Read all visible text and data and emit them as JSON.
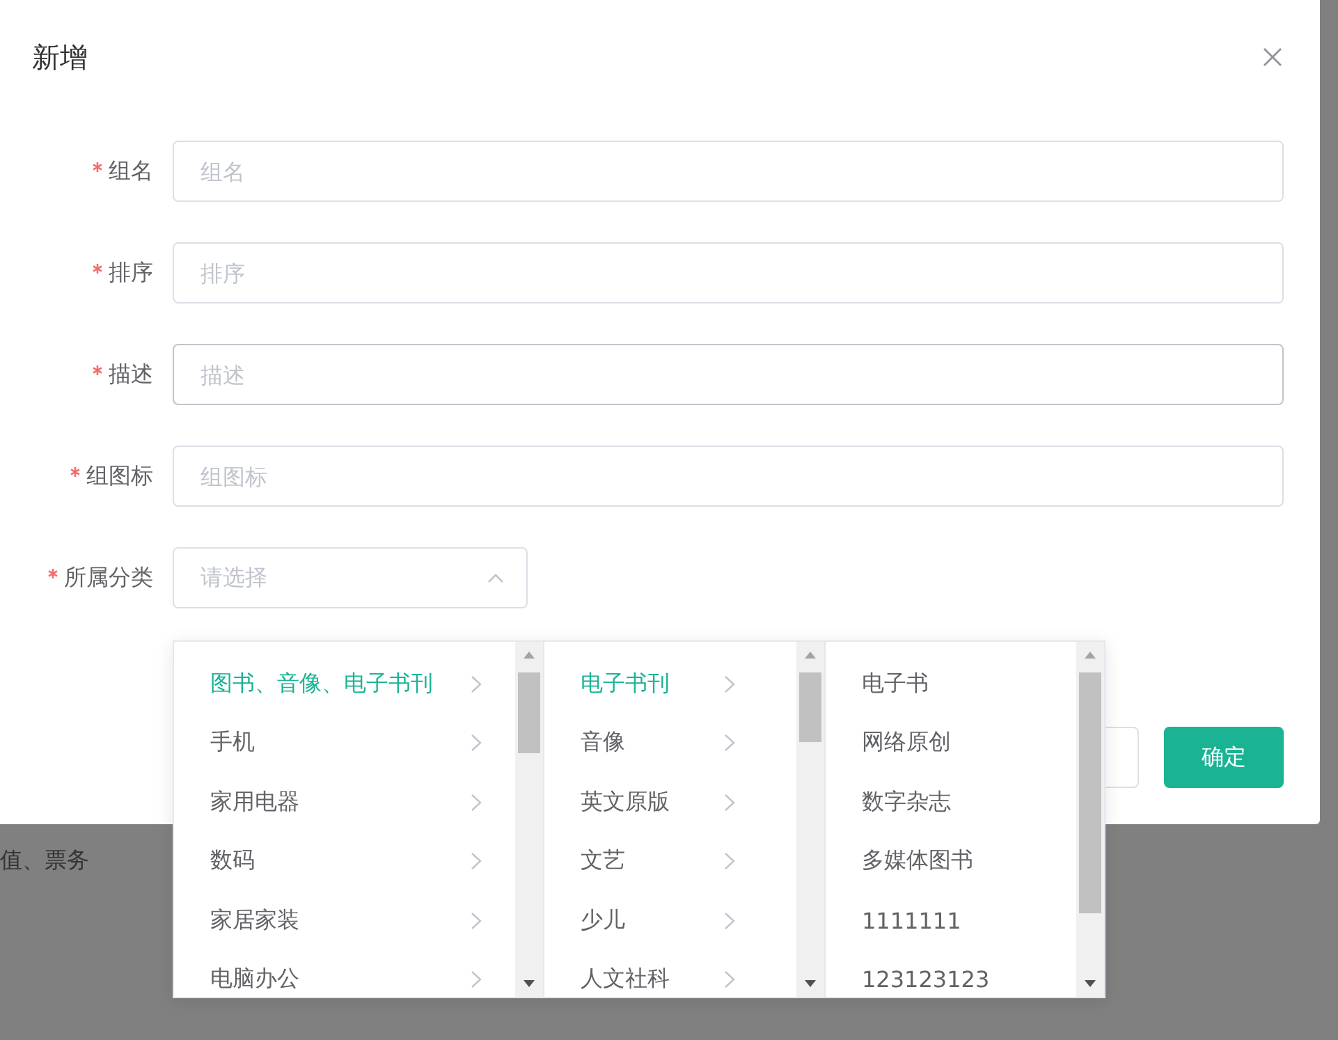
{
  "dialog": {
    "title": "新增",
    "fields": [
      {
        "label": "组名",
        "placeholder": "组名",
        "required": true,
        "kind": "input"
      },
      {
        "label": "排序",
        "placeholder": "排序",
        "required": true,
        "kind": "input"
      },
      {
        "label": "描述",
        "placeholder": "描述",
        "required": true,
        "kind": "input"
      },
      {
        "label": "组图标",
        "placeholder": "组图标",
        "required": true,
        "kind": "input"
      },
      {
        "label": "所属分类",
        "placeholder": "请选择",
        "required": true,
        "kind": "select",
        "expanded": true
      }
    ],
    "cascader": {
      "columns": [
        {
          "items": [
            {
              "label": "图书、音像、电子书刊",
              "selected": true,
              "has_children": true
            },
            {
              "label": "手机",
              "selected": false,
              "has_children": true
            },
            {
              "label": "家用电器",
              "selected": false,
              "has_children": true
            },
            {
              "label": "数码",
              "selected": false,
              "has_children": true
            },
            {
              "label": "家居家装",
              "selected": false,
              "has_children": true
            },
            {
              "label": "电脑办公",
              "selected": false,
              "has_children": true
            }
          ]
        },
        {
          "items": [
            {
              "label": "电子书刊",
              "selected": true,
              "has_children": true
            },
            {
              "label": "音像",
              "selected": false,
              "has_children": true
            },
            {
              "label": "英文原版",
              "selected": false,
              "has_children": true
            },
            {
              "label": "文艺",
              "selected": false,
              "has_children": true
            },
            {
              "label": "少儿",
              "selected": false,
              "has_children": true
            },
            {
              "label": "人文社科",
              "selected": false,
              "has_children": true
            }
          ]
        },
        {
          "items": [
            {
              "label": "电子书",
              "selected": false,
              "has_children": false
            },
            {
              "label": "网络原创",
              "selected": false,
              "has_children": false
            },
            {
              "label": "数字杂志",
              "selected": false,
              "has_children": false
            },
            {
              "label": "多媒体图书",
              "selected": false,
              "has_children": false
            },
            {
              "label": "1111111",
              "selected": false,
              "has_children": false
            },
            {
              "label": "123123123",
              "selected": false,
              "has_children": false
            }
          ]
        }
      ]
    },
    "buttons": [
      {
        "kind": "default"
      },
      {
        "kind": "primary",
        "label": "确定"
      }
    ]
  },
  "background": {
    "text": "值、票务"
  }
}
